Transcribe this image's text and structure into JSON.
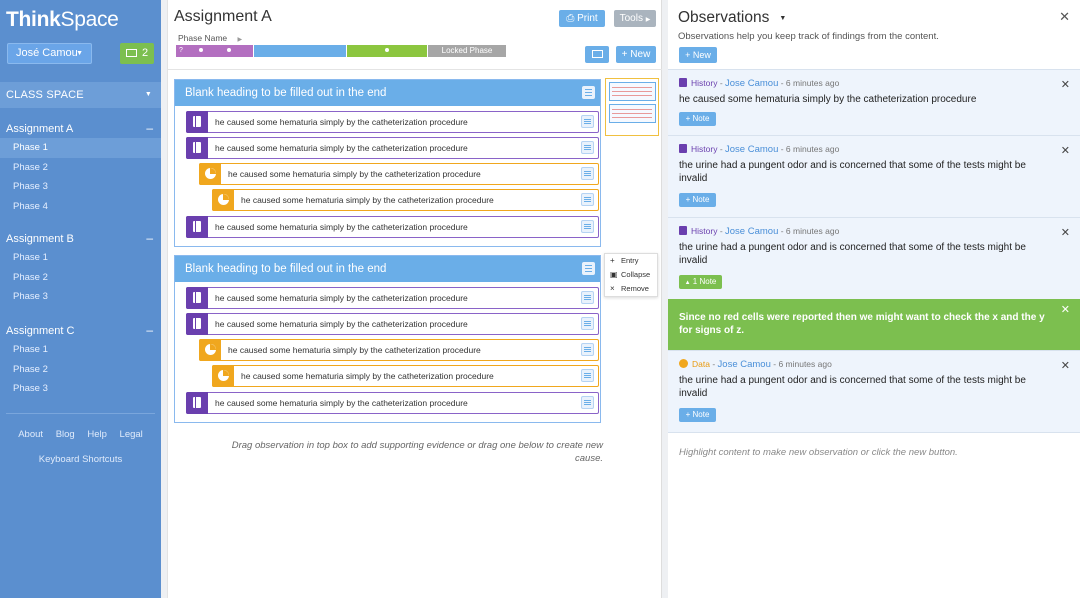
{
  "app": {
    "logo_bold": "Think",
    "logo_rest": "Space"
  },
  "user": {
    "name": "José Camou",
    "message_count": "2"
  },
  "sidebar": {
    "class_space": "CLASS SPACE",
    "assignments": [
      {
        "label": "Assignment A",
        "phases": [
          "Phase 1",
          "Phase 2",
          "Phase 3",
          "Phase 4"
        ],
        "active_phase": 0
      },
      {
        "label": "Assignment B",
        "phases": [
          "Phase 1",
          "Phase 2",
          "Phase 3"
        ]
      },
      {
        "label": "Assignment C",
        "phases": [
          "Phase 1",
          "Phase 2",
          "Phase 3"
        ]
      }
    ],
    "footer": {
      "about": "About",
      "blog": "Blog",
      "help": "Help",
      "legal": "Legal",
      "shortcuts": "Keyboard Shortcuts"
    }
  },
  "main": {
    "title": "Assignment A",
    "print_label": "Print",
    "tools_label": "Tools",
    "new_label": "New",
    "phase_name": "Phase Name",
    "locked_phase": "Locked Phase",
    "phase_colors": [
      "#b36fc0",
      "#6aaee8",
      "#8cc63f",
      "#a6a6a6"
    ],
    "causes": [
      {
        "heading": "Blank heading to be filled out in the end",
        "evidence": [
          {
            "text": "he caused some hematuria simply by the catheterization procedure",
            "type": "history",
            "indent": 0
          },
          {
            "text": "he caused some hematuria simply by the catheterization procedure",
            "type": "history",
            "indent": 0
          },
          {
            "text": "he caused some hematuria simply by the catheterization procedure",
            "type": "data",
            "indent": 1
          },
          {
            "text": "he caused some hematuria simply by the catheterization procedure",
            "type": "data",
            "indent": 2
          },
          {
            "text": "he caused some hematuria simply by the catheterization procedure",
            "type": "history",
            "indent": 0
          }
        ]
      },
      {
        "heading": "Blank heading to be filled out in the end",
        "evidence": [
          {
            "text": "he caused some hematuria simply by the catheterization procedure",
            "type": "history",
            "indent": 0
          },
          {
            "text": "he caused some hematuria simply by the catheterization procedure",
            "type": "history",
            "indent": 0
          },
          {
            "text": "he caused some hematuria simply by the catheterization procedure",
            "type": "data",
            "indent": 1
          },
          {
            "text": "he caused some hematuria simply by the catheterization procedure",
            "type": "data",
            "indent": 2
          },
          {
            "text": "he caused some hematuria simply by the catheterization procedure",
            "type": "history",
            "indent": 0
          }
        ]
      }
    ],
    "context_menu": {
      "entry": "Entry",
      "collapse": "Collapse",
      "remove": "Remove"
    },
    "drag_hint": "Drag observation in top box to add supporting evidence or drag one below to create new cause."
  },
  "observations": {
    "title": "Observations",
    "subtitle": "Observations help you keep track of findings from the content.",
    "new_label": "New",
    "cards": [
      {
        "source": "History",
        "author": "Jose Camou",
        "time": "6 minutes ago",
        "text": "he caused some hematuria simply by the catheterization procedure",
        "note_label": "Note"
      },
      {
        "source": "History",
        "author": "Jose Camou",
        "time": "6 minutes ago",
        "text": "the urine had a pungent odor and is concerned that some of the tests might be invalid",
        "note_label": "Note"
      },
      {
        "source": "History",
        "author": "Jose Camou",
        "time": "6 minutes ago",
        "text": "the urine had a pungent odor and is concerned that some of the tests might be invalid",
        "note_label": "1 Note"
      },
      {
        "source": "Data",
        "author": "Jose Camou",
        "time": "6 minutes ago",
        "text": "the urine had a pungent odor and is concerned that some of the tests might be invalid",
        "note_label": "Note"
      }
    ],
    "note_text": "Since no red cells were reported then we might want to check the x and the y for signs of z.",
    "hint": "Highlight content to make new observation or click the new button."
  }
}
